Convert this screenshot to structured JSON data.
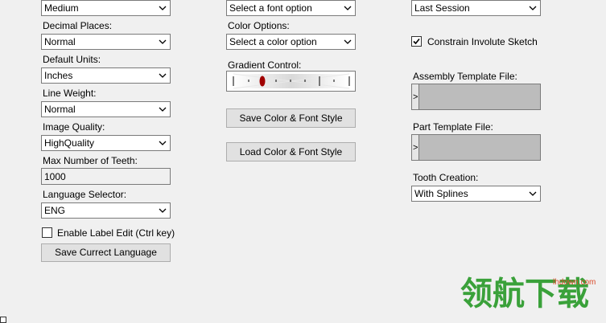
{
  "col1": {
    "top_select_value": "Medium",
    "decimal_places": {
      "label": "Decimal Places:",
      "value": "Normal"
    },
    "default_units": {
      "label": "Default Units:",
      "value": "Inches"
    },
    "line_weight": {
      "label": "Line Weight:",
      "value": "Normal"
    },
    "image_quality": {
      "label": "Image Quality:",
      "value": "HighQuality"
    },
    "max_teeth": {
      "label": "Max Number of Teeth:",
      "value": "1000"
    },
    "language": {
      "label": "Language Selector:",
      "value": "ENG"
    },
    "enable_label_edit": {
      "label": "Enable Label Edit (Ctrl key)",
      "checked": false
    },
    "save_language_button": "Save Currect Language"
  },
  "col2": {
    "font_select_value": "Select a font option",
    "color_options": {
      "label": "Color Options:",
      "value": "Select a color option"
    },
    "gradient": {
      "label": "Gradient Control:"
    },
    "save_style_button": "Save Color & Font Style",
    "load_style_button": "Load Color & Font Style"
  },
  "col3": {
    "session_select_value": "Last Session",
    "constrain_involute": {
      "label": "Constrain Involute Sketch",
      "checked": true
    },
    "assembly_template": {
      "label": "Assembly Template File:",
      "expand_glyph": ">"
    },
    "part_template": {
      "label": "Part Template File:",
      "expand_glyph": ">"
    },
    "tooth_creation": {
      "label": "Tooth Creation:",
      "value": "With Splines"
    }
  },
  "watermark": {
    "text": "领航下载",
    "site": "lhdown.com"
  },
  "icons": {
    "dropdown": "chevron-down-icon",
    "check": "checkmark-icon"
  },
  "colors": {
    "background": "#f0f0f0",
    "slider_thumb": "#a00000",
    "watermark_green": "#3aa13a"
  }
}
